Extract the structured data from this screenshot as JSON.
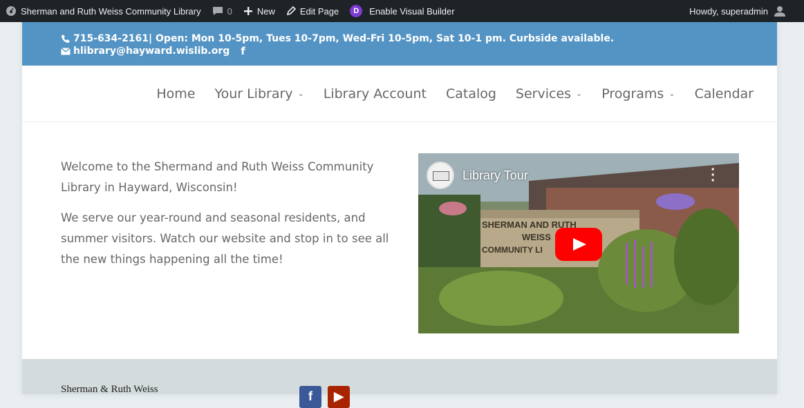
{
  "admin_bar": {
    "site_name": "Sherman and Ruth Weiss Community Library",
    "comments_count": "0",
    "new_label": "New",
    "edit_label": "Edit Page",
    "builder_badge": "D",
    "builder_label": "Enable Visual Builder",
    "howdy": "Howdy, superadmin"
  },
  "top_bar": {
    "phone_hours": "715-634-2161| Open: Mon 10-5pm, Tues 10-7pm, Wed-Fri 10-5pm, Sat 10-1 pm. Curbside available.",
    "email": "hlibrary@hayward.wislib.org",
    "facebook_glyph": "f"
  },
  "nav": {
    "items": [
      {
        "label": "Home",
        "dropdown": false
      },
      {
        "label": "Your Library",
        "dropdown": true
      },
      {
        "label": "Library Account",
        "dropdown": false
      },
      {
        "label": "Catalog",
        "dropdown": false
      },
      {
        "label": "Services",
        "dropdown": true
      },
      {
        "label": "Programs",
        "dropdown": true
      },
      {
        "label": "Calendar",
        "dropdown": false
      }
    ],
    "chevron": "⌄"
  },
  "main": {
    "intro": "Welcome to the Shermand and Ruth Weiss Community Library in Hayward, Wisconsin!",
    "body": "We serve our year-round and seasonal residents, and summer visitors. Watch our website and stop in to see all the new things happening all the time!"
  },
  "video": {
    "title": "Library Tour",
    "sign_line1": "SHERMAN AND RUTH",
    "sign_line2": "WEISS",
    "sign_line3": "COMMUNITY LI"
  },
  "footer": {
    "text": "Sherman & Ruth Weiss",
    "facebook_glyph": "f",
    "youtube_glyph": "▶"
  },
  "colors": {
    "admin_bar": "#1d2327",
    "top_bar": "#5494c4",
    "footer": "#d4dbdd",
    "play_button": "#ff0000"
  }
}
